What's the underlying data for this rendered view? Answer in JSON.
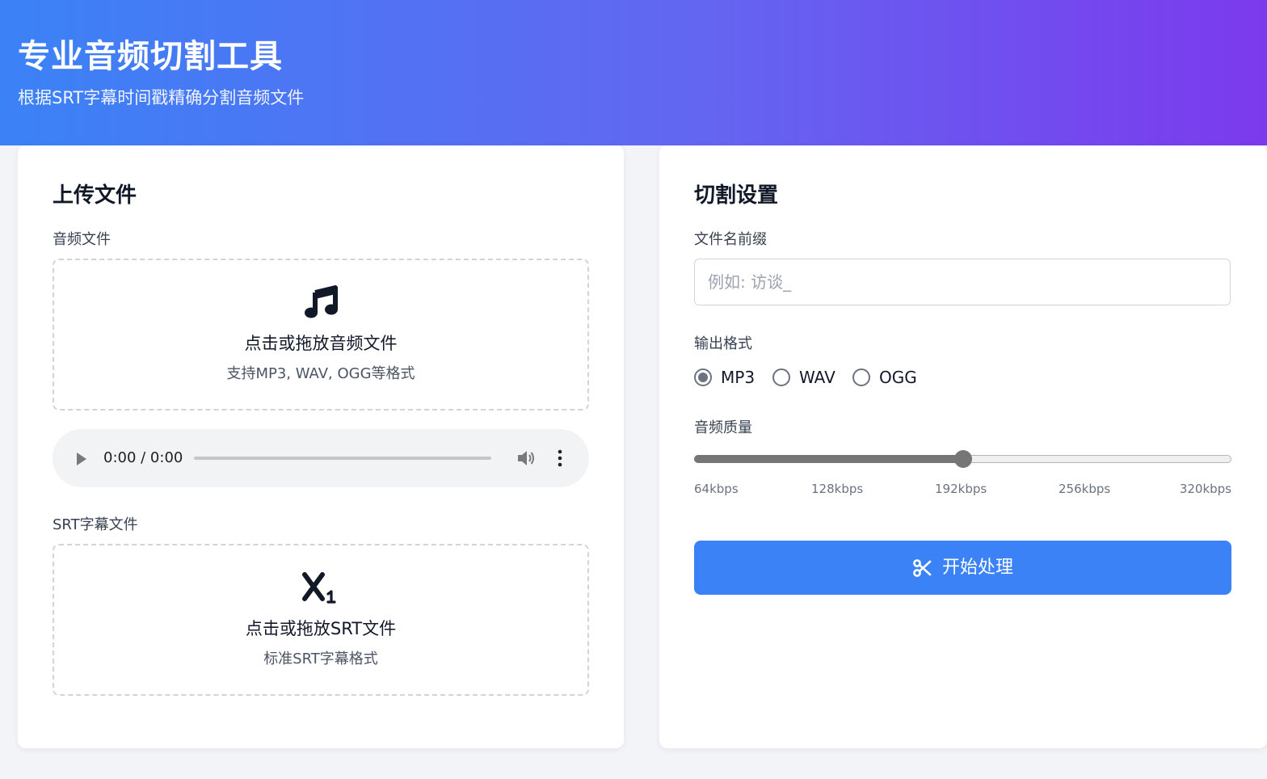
{
  "header": {
    "title": "专业音频切割工具",
    "subtitle": "根据SRT字幕时间戳精确分割音频文件"
  },
  "upload": {
    "heading": "上传文件",
    "audio_label": "音频文件",
    "audio_drop_title": "点击或拖放音频文件",
    "audio_drop_hint": "支持MP3, WAV, OGG等格式",
    "player_time": "0:00 / 0:00",
    "srt_label": "SRT字幕文件",
    "srt_drop_title": "点击或拖放SRT文件",
    "srt_drop_hint": "标准SRT字幕格式"
  },
  "settings": {
    "heading": "切割设置",
    "prefix_label": "文件名前缀",
    "prefix_placeholder": "例如: 访谈_",
    "prefix_value": "",
    "format_label": "输出格式",
    "formats": [
      {
        "label": "MP3",
        "checked": true
      },
      {
        "label": "WAV",
        "checked": false
      },
      {
        "label": "OGG",
        "checked": false
      }
    ],
    "quality_label": "音频质量",
    "quality_ticks": [
      "64kbps",
      "128kbps",
      "192kbps",
      "256kbps",
      "320kbps"
    ],
    "quality_selected": "192kbps",
    "quality_fraction": 0.5,
    "process_button": "开始处理"
  },
  "colors": {
    "accent": "#3b82f6",
    "header_gradient_start": "#3b82f6",
    "header_gradient_end": "#7c3aed"
  },
  "icons": {
    "audio": "music-note-icon",
    "srt": "subscript-icon",
    "button": "scissors-icon"
  }
}
